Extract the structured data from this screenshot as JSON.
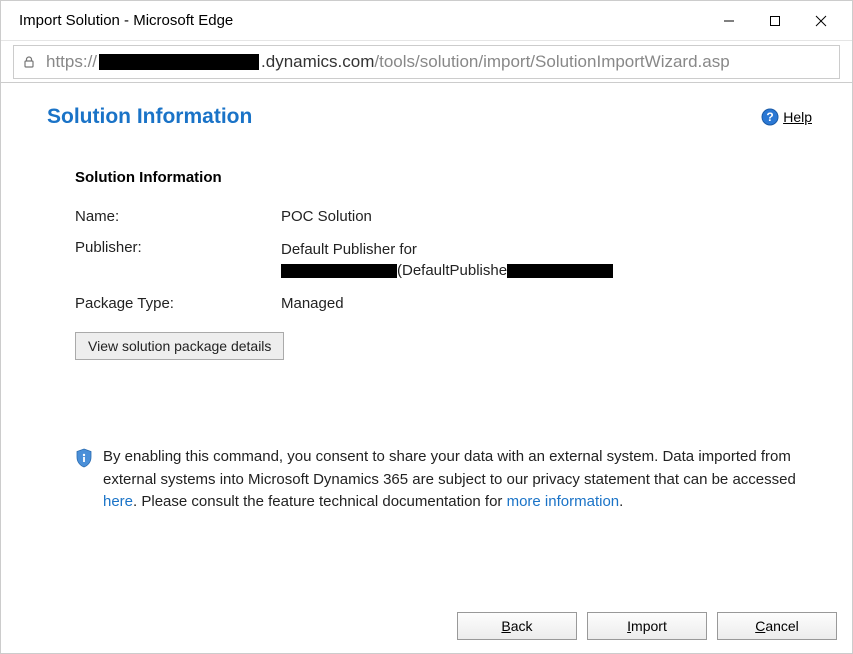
{
  "window": {
    "title": "Import Solution - Microsoft Edge"
  },
  "address": {
    "scheme": "https://",
    "host_suffix": ".dynamics.com",
    "path": "/tools/solution/import/SolutionImportWizard.asp"
  },
  "page": {
    "title": "Solution Information",
    "help_label": "Help"
  },
  "section": {
    "title": "Solution Information",
    "name_label": "Name:",
    "name_value": "POC Solution",
    "publisher_label": "Publisher:",
    "publisher_value_line1": "Default Publisher for",
    "publisher_value_mid": "(DefaultPublishe",
    "package_type_label": "Package Type:",
    "package_type_value": "Managed",
    "details_button": "View solution package details"
  },
  "consent": {
    "text_pre": "By enabling this command, you consent to share your data with an external system. Data imported from external systems into Microsoft Dynamics 365 are subject to our privacy statement that can be accessed ",
    "link_here": "here",
    "text_mid": ". Please consult the feature technical documentation for ",
    "link_more": "more information",
    "text_end": "."
  },
  "footer": {
    "back": "Back",
    "import": "Import",
    "cancel": "Cancel"
  }
}
